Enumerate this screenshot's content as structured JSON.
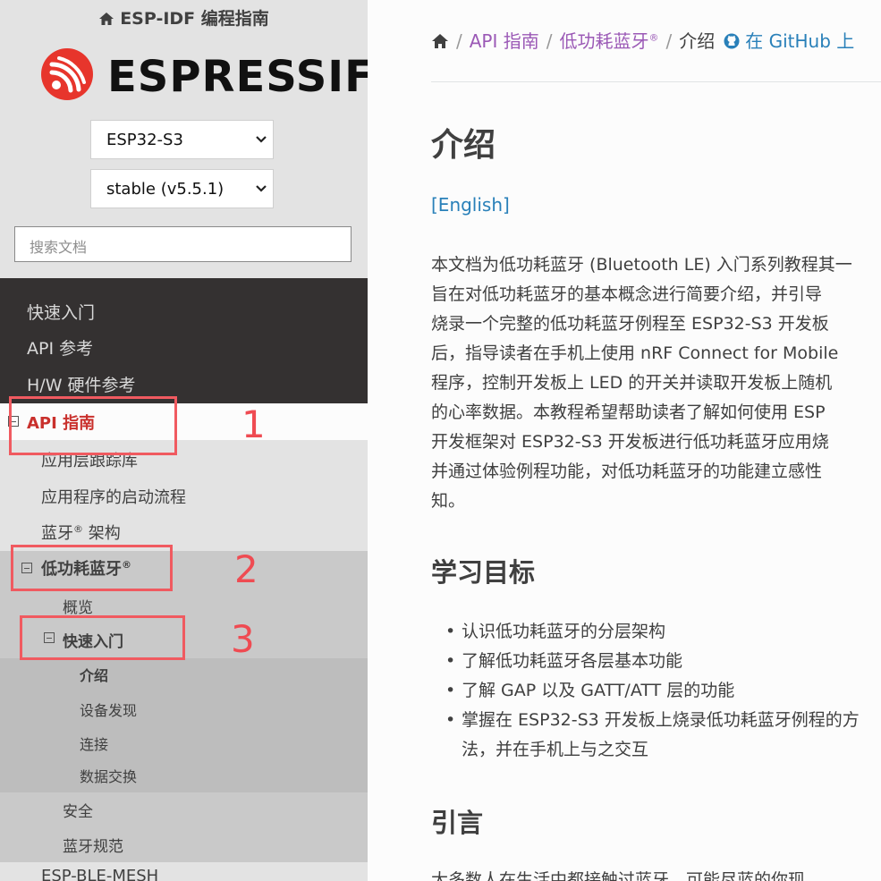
{
  "sidebar": {
    "project_title": "ESP-IDF 编程指南",
    "logo_text": "ESPRESSIF",
    "target_select": "ESP32-S3",
    "version_select": "stable (v5.5.1)",
    "search_placeholder": "搜索文档",
    "top_items": [
      "快速入门",
      "API 参考",
      "H/W 硬件参考"
    ],
    "api_guide": "API 指南",
    "l2_items_before": [
      "应用层跟踪库",
      "应用程序的启动流程"
    ],
    "bt_arch": "蓝牙",
    "ble": "低功耗蓝牙",
    "reg_mark": "®",
    "overview": "概览",
    "get_started": "快速入门",
    "l4_items": [
      "介绍",
      "设备发现",
      "连接",
      "数据交换"
    ],
    "l3_after": [
      "安全",
      "蓝牙规范"
    ],
    "next_item": "ESP-BLE-MESH",
    "annotations": [
      "1",
      "2",
      "3"
    ]
  },
  "breadcrumb": {
    "api_guide": "API 指南",
    "ble": "低功耗蓝牙",
    "reg_mark": "®",
    "current": "介绍",
    "github": "在 GitHub 上"
  },
  "main": {
    "title": "介绍",
    "english_link": "[English]",
    "intro_lines": [
      "本文档为低功耗蓝牙 (Bluetooth LE) 入门系列教程其一",
      "旨在对低功耗蓝牙的基本概念进行简要介绍，并引导",
      "烧录一个完整的低功耗蓝牙例程至 ESP32-S3 开发板",
      "后，指导读者在手机上使用 nRF Connect for Mobile",
      "程序，控制开发板上 LED 的开关并读取开发板上随机",
      "的心率数据。本教程希望帮助读者了解如何使用 ESP",
      "开发框架对 ESP32-S3 开发板进行低功耗蓝牙应用烧",
      "并通过体验例程功能，对低功耗蓝牙的功能建立感性",
      "知。"
    ],
    "goals_heading": "学习目标",
    "goals": [
      "认识低功耗蓝牙的分层架构",
      "了解低功耗蓝牙各层基本功能",
      "了解 GAP 以及 GATT/ATT 层的功能",
      "掌握在 ESP32-S3 开发板上烧录低功耗蓝牙例程的方"
    ],
    "goal_cont": "法，并在手机上与之交互",
    "intro_heading": "引言",
    "cut_line": "大多数人在生活中都接触过蓝牙，可能尽蓝的你现"
  },
  "colors": {
    "accent_red": "#f05a60",
    "link": "#2980b9",
    "visited": "#9b59b6",
    "dark_nav": "#343131"
  }
}
